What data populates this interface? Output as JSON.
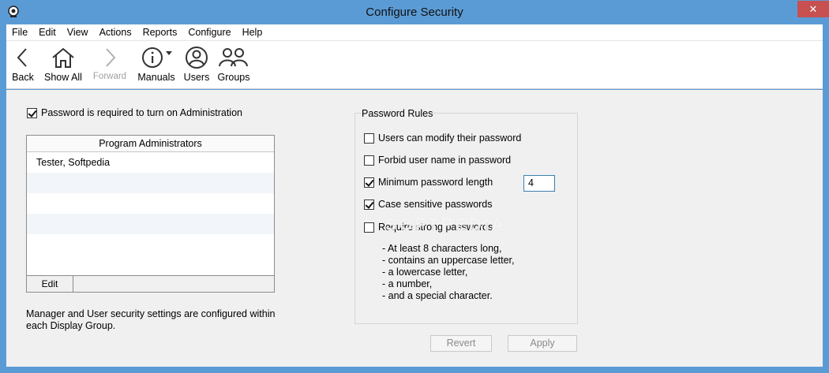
{
  "window": {
    "title": "Configure Security",
    "close_glyph": "✕",
    "accent_color": "#5b9bd5",
    "close_color": "#c75050"
  },
  "menu": [
    "File",
    "Edit",
    "View",
    "Actions",
    "Reports",
    "Configure",
    "Help"
  ],
  "toolbar": {
    "back": {
      "label": "Back",
      "icon": "back-arrow-icon"
    },
    "show_all": {
      "label": "Show All",
      "icon": "home-icon"
    },
    "forward": {
      "label": "Forward",
      "icon": "forward-arrow-icon",
      "disabled": true
    },
    "manuals": {
      "label": "Manuals",
      "icon": "info-icon"
    },
    "users": {
      "label": "Users",
      "icon": "user-icon"
    },
    "groups": {
      "label": "Groups",
      "icon": "groups-icon"
    }
  },
  "admin": {
    "password_required_label": "Password is required to turn on Administration",
    "password_required_checked": true,
    "table_header": "Program Administrators",
    "rows": [
      "Tester, Softpedia",
      "",
      "",
      "",
      "",
      ""
    ],
    "edit_label": "Edit",
    "note": "Manager and User security settings are configured within each Display Group."
  },
  "rules": {
    "title": "Password Rules",
    "items": [
      {
        "label": "Users can modify their password",
        "checked": false
      },
      {
        "label": "Forbid user name in password",
        "checked": false
      },
      {
        "label": "Minimum password length",
        "checked": true
      },
      {
        "label": "Case sensitive passwords",
        "checked": true
      },
      {
        "label": "Require strong passwords",
        "checked": false
      }
    ],
    "min_length_value": "4",
    "strong_bullets": [
      "-  At least 8 characters long,",
      "-  contains an uppercase letter,",
      "-  a lowercase letter,",
      "-  a number,",
      "-  and a special character."
    ]
  },
  "buttons": {
    "revert": "Revert",
    "apply": "Apply"
  },
  "watermark": "SOFTPEDIA"
}
